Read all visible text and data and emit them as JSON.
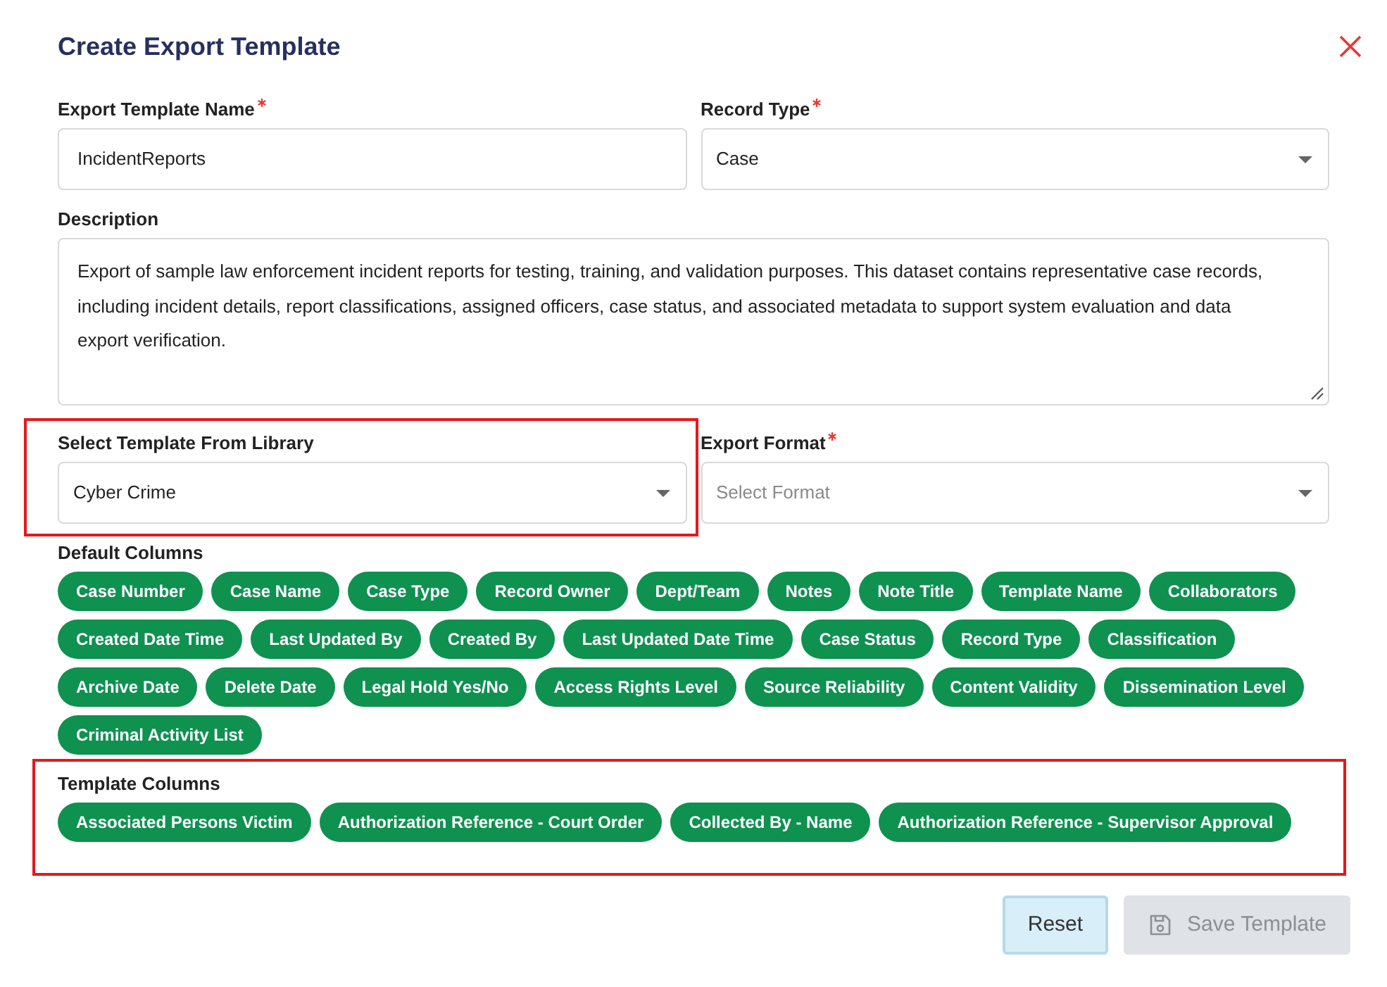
{
  "dialog": {
    "title": "Create Export Template"
  },
  "fields": [
    {
      "kind": "text",
      "label": "Export Template Name",
      "required": true,
      "value": "IncidentReports"
    },
    {
      "kind": "select",
      "label": "Record Type",
      "required": true,
      "value": "Case"
    },
    {
      "kind": "textarea",
      "label": "Description",
      "value": "Export of sample law enforcement incident reports for testing, training, and validation purposes. This dataset contains representative case records, including incident details, report classifications, assigned officers, case status, and associated metadata to support system evaluation and data export verification."
    },
    {
      "kind": "select",
      "label": "Select Template From Library",
      "value": "Cyber Crime",
      "highlighted": true
    },
    {
      "kind": "select",
      "label": "Export Format",
      "required": true,
      "placeholder": "Select Format"
    }
  ],
  "default_columns": {
    "label": "Default Columns",
    "chips": [
      "Case Number",
      "Case Name",
      "Case Type",
      "Record Owner",
      "Dept/Team",
      "Notes",
      "Note Title",
      "Template Name",
      "Collaborators",
      "Created Date Time",
      "Last Updated By",
      "Created By",
      "Last Updated Date Time",
      "Case Status",
      "Record Type",
      "Classification",
      "Archive Date",
      "Delete Date",
      "Legal Hold Yes/No",
      "Access Rights Level",
      "Source Reliability",
      "Content Validity",
      "Dissemination Level",
      "Criminal Activity List"
    ]
  },
  "template_columns": {
    "label": "Template Columns",
    "highlighted": true,
    "chips": [
      "Associated Persons Victim",
      "Authorization Reference - Court Order",
      "Collected By - Name",
      "Authorization Reference - Supervisor Approval"
    ]
  },
  "buttons": [
    {
      "kind": "secondary",
      "label": "Reset",
      "disabled": false
    },
    {
      "kind": "save",
      "label": "Save Template",
      "disabled": true
    }
  ]
}
